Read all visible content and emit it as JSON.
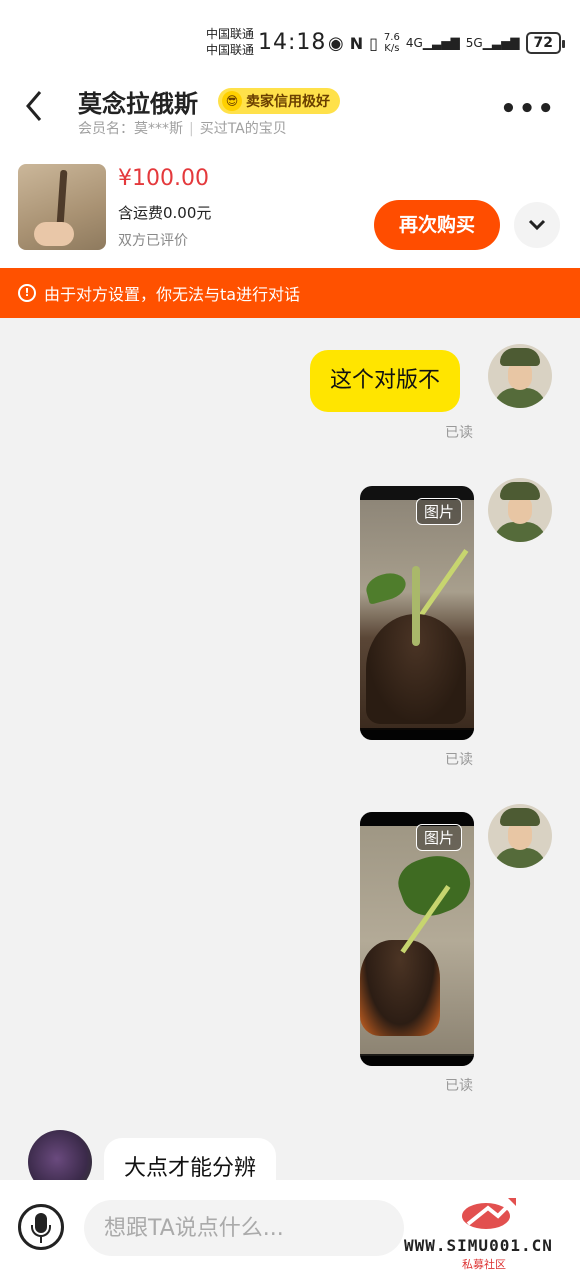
{
  "status_bar": {
    "carrier1": "中国联通",
    "carrier2": "中国联通",
    "time": "14:18",
    "net_speed_value": "7.6",
    "net_speed_unit": "K/s",
    "signal1": "4G",
    "signal2": "5G",
    "battery": "72"
  },
  "header": {
    "shop_name": "莫念拉俄斯",
    "credit_badge": "卖家信用极好",
    "member_label": "会员名：莫***斯",
    "bought_label": "买过TA的宝贝"
  },
  "product": {
    "price": "¥100.00",
    "shipping": "含运费0.00元",
    "rating_status": "双方已评价",
    "rebuy_label": "再次购买"
  },
  "notice": {
    "text": "由于对方设置，你无法与ta进行对话"
  },
  "messages": [
    {
      "sender": "me",
      "type": "text",
      "content": "这个对版不",
      "status": "已读"
    },
    {
      "sender": "me",
      "type": "image",
      "tag": "图片",
      "status": "已读"
    },
    {
      "sender": "me",
      "type": "image",
      "tag": "图片",
      "status": "已读"
    },
    {
      "sender": "other",
      "type": "text",
      "content": "大点才能分辨"
    }
  ],
  "input": {
    "placeholder": "想跟TA说点什么..."
  },
  "watermark": {
    "site": "WWW.SIMU001.CN",
    "subtitle": "私募社区"
  },
  "colors": {
    "accent_orange": "#ff5100",
    "price_red": "#e4393c",
    "my_bubble": "#ffe500",
    "badge_yellow": "#ffe14a"
  }
}
